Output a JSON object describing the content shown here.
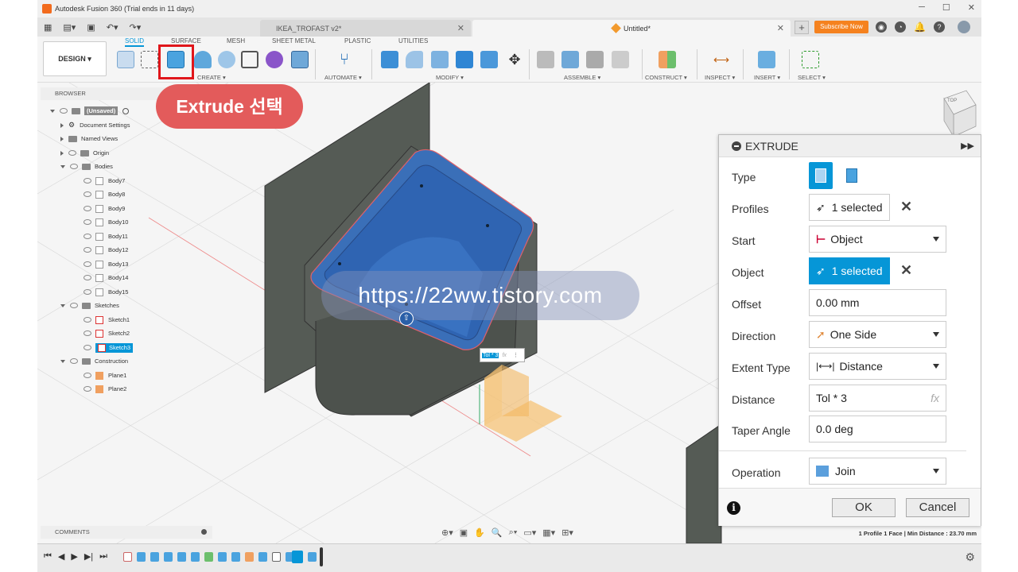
{
  "window": {
    "title": "Autodesk Fusion 360 (Trial ends in 11 days)"
  },
  "tabs": [
    {
      "label": "IKEA_TROFAST v2*"
    },
    {
      "label": "Untitled*"
    }
  ],
  "header": {
    "subscribe_label": "Subscribe Now"
  },
  "ribbon": {
    "design_label": "DESIGN ▾",
    "tabs": [
      "SOLID",
      "SURFACE",
      "MESH",
      "SHEET METAL",
      "PLASTIC",
      "UTILITIES"
    ],
    "groups": [
      "CREATE ▾",
      "AUTOMATE ▾",
      "MODIFY ▾",
      "ASSEMBLE ▾",
      "CONSTRUCT ▾",
      "INSPECT ▾",
      "INSERT ▾",
      "SELECT ▾"
    ]
  },
  "browser": {
    "header": "BROWSER",
    "root": "(Unsaved)",
    "items": [
      "Document Settings",
      "Named Views",
      "Origin",
      "Bodies",
      "Body7",
      "Body8",
      "Body9",
      "Body10",
      "Body11",
      "Body12",
      "Body13",
      "Body14",
      "Body15",
      "Sketches",
      "Sketch1",
      "Sketch2",
      "Sketch3",
      "Construction",
      "Plane1",
      "Plane2"
    ]
  },
  "annotation": {
    "text": "Extrude 선택"
  },
  "watermark": "https://22ww.tistory.com",
  "viewport": {
    "input_value": "Tol * 3",
    "input_fx": "fx",
    "viewcube_label": "TOP"
  },
  "extrude": {
    "title": "EXTRUDE",
    "type_label": "Type",
    "profiles_label": "Profiles",
    "profiles_value": "1 selected",
    "start_label": "Start",
    "start_value": "Object",
    "object_label": "Object",
    "object_value": "1 selected",
    "offset_label": "Offset",
    "offset_value": "0.00 mm",
    "direction_label": "Direction",
    "direction_value": "One Side",
    "extent_label": "Extent Type",
    "extent_value": "Distance",
    "distance_label": "Distance",
    "distance_value": "Tol * 3",
    "distance_fx": "fx",
    "taper_label": "Taper Angle",
    "taper_value": "0.0 deg",
    "operation_label": "Operation",
    "operation_value": "Join",
    "ok_label": "OK",
    "cancel_label": "Cancel"
  },
  "comments": {
    "header": "COMMENTS"
  },
  "status": {
    "text": "1 Profile 1 Face | Min Distance : 23.70 mm"
  },
  "colors": {
    "accent": "#0696d7",
    "highlight": "#e0161b",
    "annotation_bg": "#e35b5b",
    "subscribe": "#f5821f"
  }
}
